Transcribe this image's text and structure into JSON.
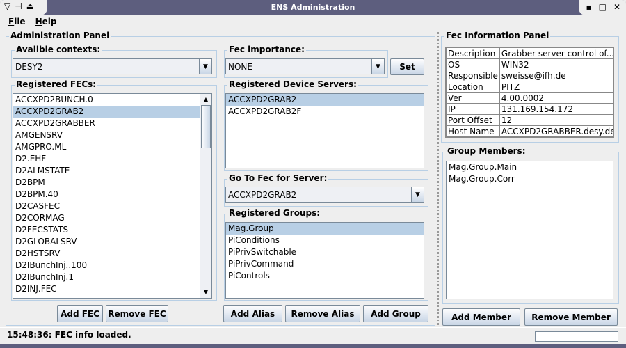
{
  "window": {
    "title": "ENS Administration"
  },
  "menu": [
    "File",
    "Help"
  ],
  "admin_panel": {
    "title": "Administration Panel",
    "contexts": {
      "label": "Avalible contexts:",
      "value": "DESY2"
    },
    "importance": {
      "label": "Fec importance:",
      "value": "NONE",
      "set_label": "Set"
    },
    "fecs": {
      "label": "Registered FECs:",
      "items": [
        "ACCXPD2BUNCH.0",
        "ACCXPD2GRAB2",
        "ACCXPD2GRABBER",
        "AMGENSRV",
        "AMGPRO.ML",
        "D2.EHF",
        "D2ALMSTATE",
        "D2BPM",
        "D2BPM.40",
        "D2CASFEC",
        "D2CORMAG",
        "D2FECSTATS",
        "D2GLOBALSRV",
        "D2HSTSRV",
        "D2IBunchInj..100",
        "D2IBunchInj.1",
        "D2INJ.FEC"
      ],
      "selected": 1
    },
    "device_servers": {
      "label": "Registered Device Servers:",
      "items": [
        "ACCXPD2GRAB2",
        "ACCXPD2GRAB2F"
      ],
      "selected": 0
    },
    "goto_fec": {
      "label": "Go To Fec for Server:",
      "value": "ACCXPD2GRAB2"
    },
    "groups": {
      "label": "Registered Groups:",
      "items": [
        "Mag.Group",
        "PiConditions",
        "PiPrivSwitchable",
        "PiPrivCommand",
        "PiControls"
      ],
      "selected": 0
    },
    "buttons": {
      "add_fec": "Add FEC",
      "remove_fec": "Remove FEC",
      "add_alias": "Add Alias",
      "remove_alias": "Remove Alias",
      "add_group": "Add Group"
    }
  },
  "info_panel": {
    "title": "Fec Information Panel",
    "rows": [
      [
        "Description",
        "Grabber server control of..."
      ],
      [
        "OS",
        "WIN32"
      ],
      [
        "Responsible",
        "sweisse@ifh.de"
      ],
      [
        "Location",
        "PITZ"
      ],
      [
        "Ver",
        "4.00.0002"
      ],
      [
        "IP",
        "131.169.154.172"
      ],
      [
        "Port Offset",
        "12"
      ],
      [
        "Host Name",
        "ACCXPD2GRABBER.desy.de"
      ]
    ],
    "members": {
      "label": "Group Members:",
      "items": [
        "Mag.Group.Main",
        "Mag.Group.Corr"
      ]
    },
    "buttons": {
      "add_member": "Add Member",
      "remove_member": "Remove Member"
    }
  },
  "status": {
    "text": "15:48:36: FEC info loaded."
  }
}
